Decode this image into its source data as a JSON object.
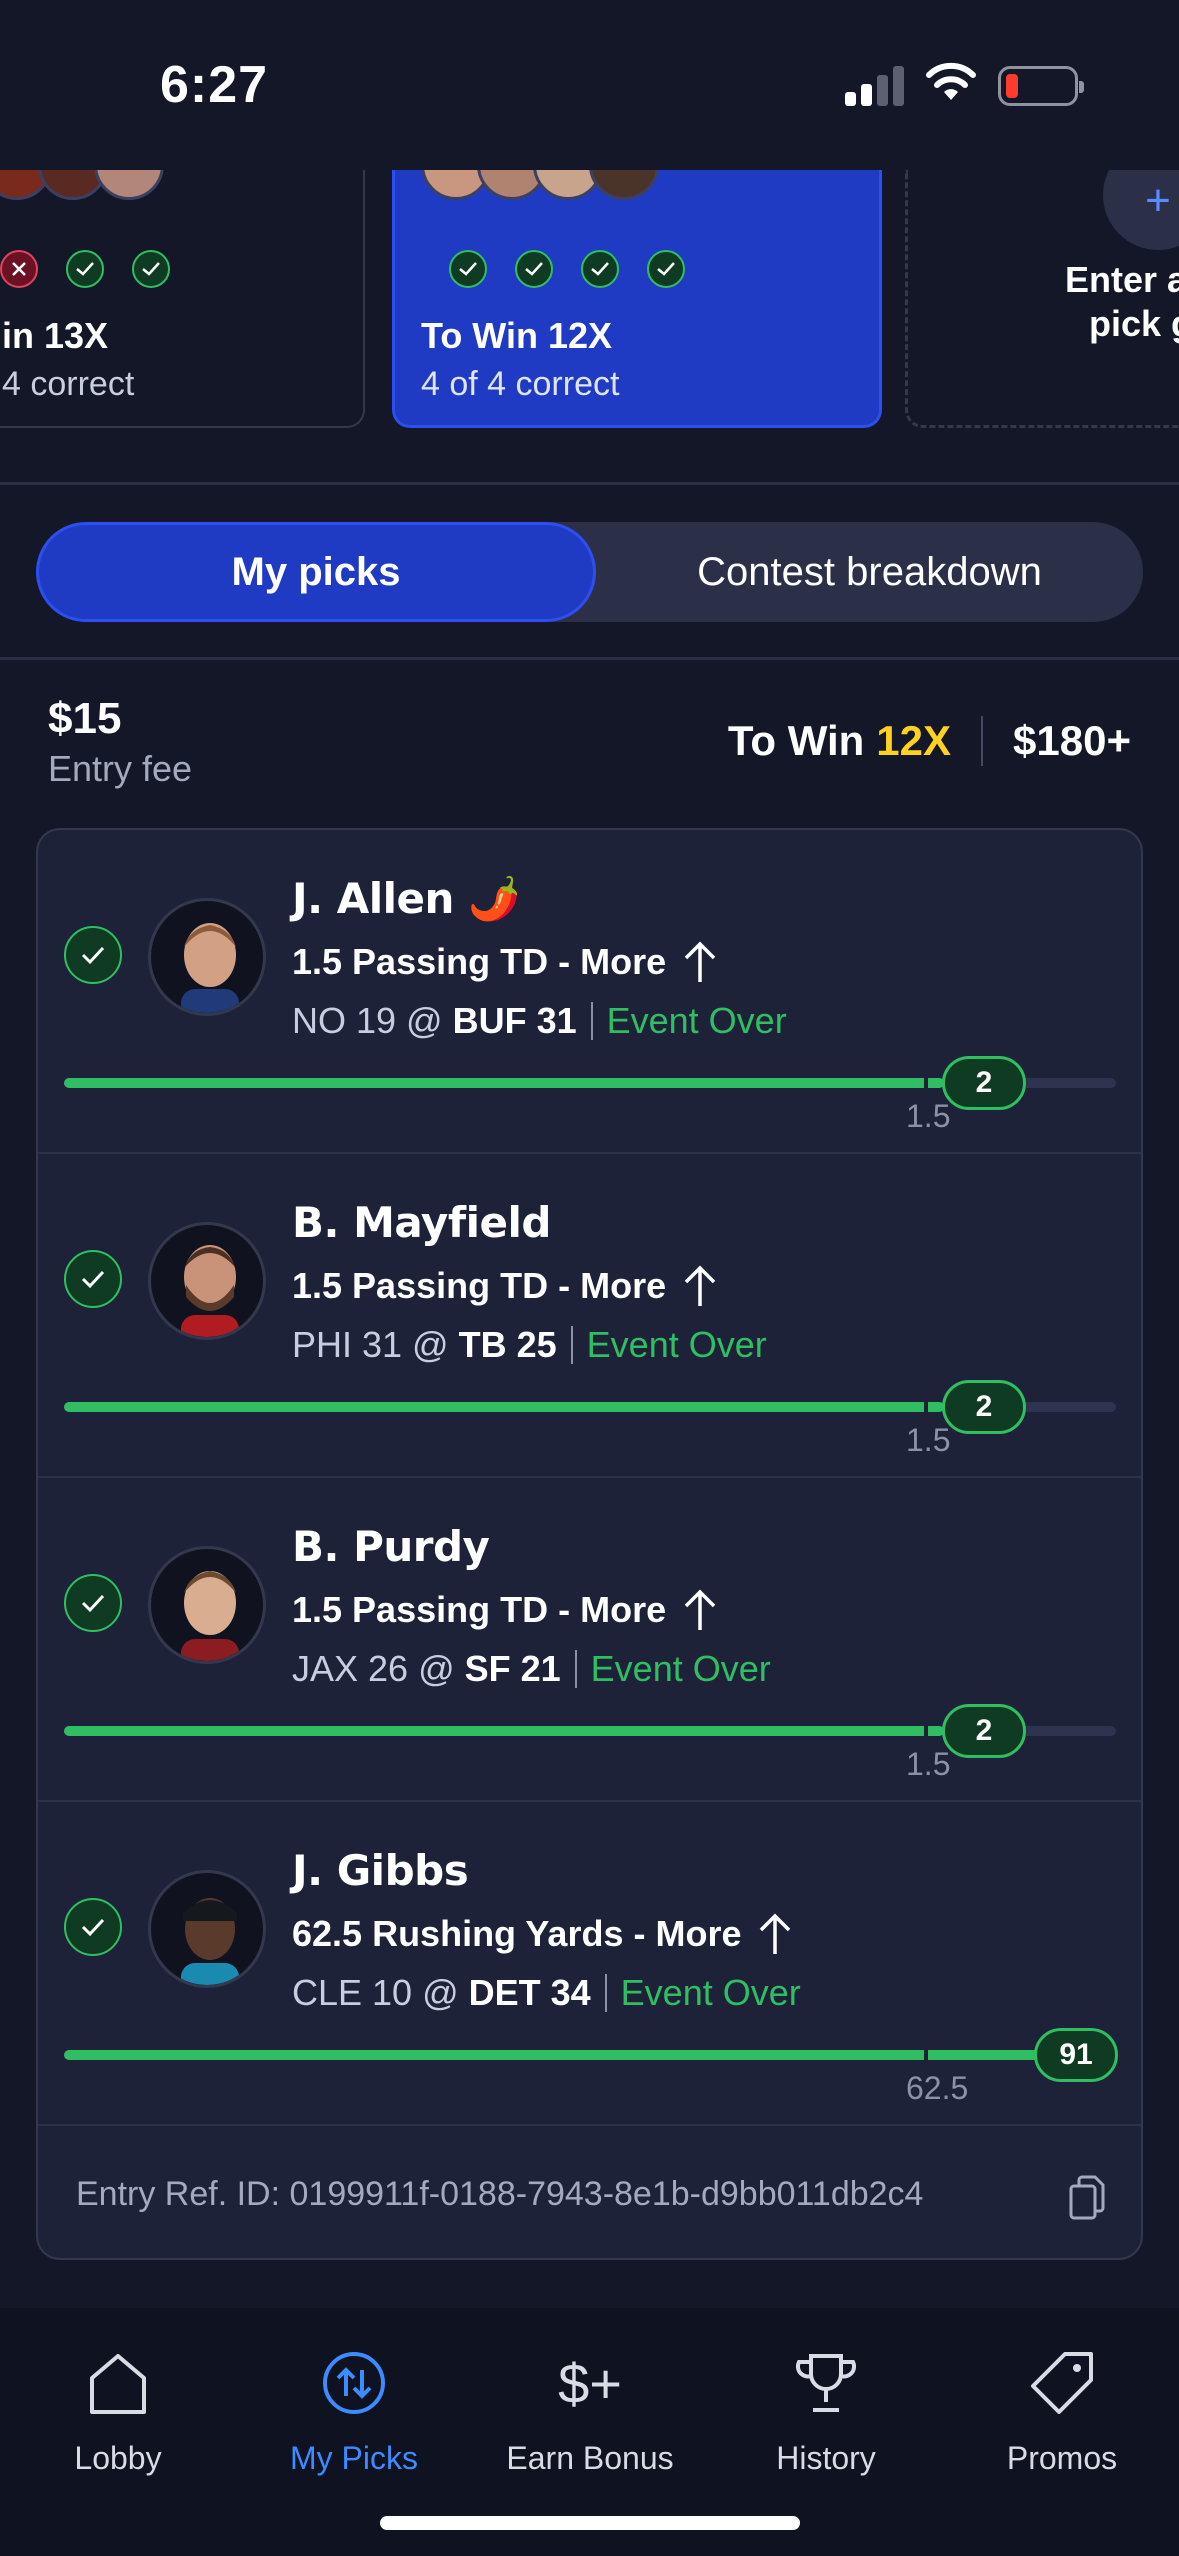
{
  "status_bar": {
    "time": "6:27"
  },
  "carousel": {
    "cards": [
      {
        "title": "in 13X",
        "subtitle": "4 correct",
        "results": [
          "x",
          "check",
          "check"
        ]
      },
      {
        "title": "To Win 12X",
        "subtitle": "4 of 4 correct",
        "results": [
          "check",
          "check",
          "check",
          "check"
        ],
        "selected": true
      },
      {
        "title": "Enter and pick gr",
        "title_line1": "Enter and",
        "title_line2": "pick gr",
        "plus": "+"
      }
    ]
  },
  "tabs": {
    "my_picks": "My picks",
    "contest_breakdown": "Contest breakdown"
  },
  "entry": {
    "fee": "$15",
    "fee_label": "Entry fee",
    "to_win_label": "To Win",
    "multiplier": "12X",
    "payout": "$180+"
  },
  "picks": [
    {
      "name": "J. Allen",
      "emoji": "🌶️",
      "line": "1.5 Passing TD - More",
      "away": "NO 19 @",
      "home": "BUF 31",
      "status": "Event Over",
      "result": "2",
      "line_value": "1.5",
      "progress": 1.0
    },
    {
      "name": "B. Mayfield",
      "line": "1.5 Passing TD - More",
      "away": "PHI 31 @",
      "home": "TB 25",
      "status": "Event Over",
      "result": "2",
      "line_value": "1.5",
      "progress": 1.0
    },
    {
      "name": "B. Purdy",
      "line": "1.5 Passing TD - More",
      "away": "JAX 26 @",
      "home": "SF 21",
      "status": "Event Over",
      "result": "2",
      "line_value": "1.5",
      "progress": 1.0
    },
    {
      "name": "J. Gibbs",
      "line": "62.5 Rushing Yards - More",
      "away": "CLE 10 @",
      "home": "DET 34",
      "status": "Event Over",
      "result": "91",
      "line_value": "62.5",
      "progress": 1.0
    }
  ],
  "entry_ref": "Entry Ref. ID: 0199911f-0188-7943-8e1b-d9bb011db2c4",
  "nav": [
    {
      "label": "Lobby",
      "icon": "home-icon"
    },
    {
      "label": "My Picks",
      "icon": "my-picks-icon",
      "active": true
    },
    {
      "label": "Earn Bonus",
      "icon": "earn-bonus-icon"
    },
    {
      "label": "History",
      "icon": "trophy-icon"
    },
    {
      "label": "Promos",
      "icon": "tag-icon"
    }
  ],
  "colors": {
    "accent": "#1f3bc4",
    "success": "#2fbf62",
    "highlight": "#ffd21f",
    "nav_active": "#3c8bff"
  }
}
